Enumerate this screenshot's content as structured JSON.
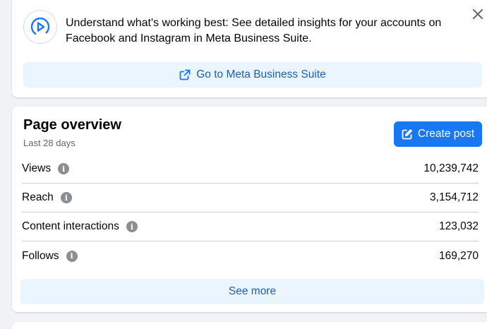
{
  "promo": {
    "text": "Understand what's working best: See detailed insights for your accounts on Facebook and Instagram in Meta Business Suite.",
    "button_label": "Go to Meta Business Suite",
    "logo_icon": "meta-business-suite-icon",
    "close_icon": "close-icon"
  },
  "overview": {
    "title": "Page overview",
    "subtitle": "Last 28 days",
    "create_post_label": "Create post",
    "metrics": [
      {
        "label": "Views",
        "value": "10,239,742"
      },
      {
        "label": "Reach",
        "value": "3,154,712"
      },
      {
        "label": "Content interactions",
        "value": "123,032"
      },
      {
        "label": "Follows",
        "value": "169,270"
      }
    ],
    "see_more_label": "See more"
  },
  "colors": {
    "accent": "#1877f2",
    "light_button": "#ebf5ff",
    "background": "#f0f2f5"
  }
}
